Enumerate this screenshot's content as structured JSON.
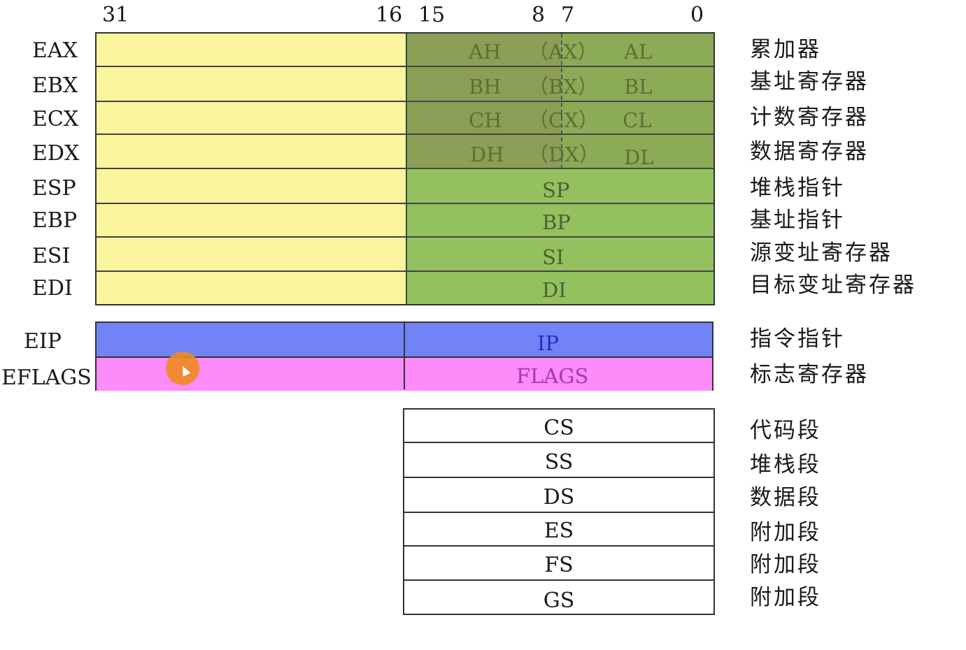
{
  "bit_labels": [
    "31",
    "16",
    "15",
    "8",
    "7",
    "0"
  ],
  "general_registers": [
    {
      "name": "EAX",
      "high": "AH",
      "word": "（AX）",
      "low": "AL",
      "desc": "累加器"
    },
    {
      "name": "EBX",
      "high": "BH",
      "word": "（BX）",
      "low": "BL",
      "desc": "基址寄存器"
    },
    {
      "name": "ECX",
      "high": "CH",
      "word": "（CX）",
      "low": "CL",
      "desc": "计数寄存器"
    },
    {
      "name": "EDX",
      "high": "DH",
      "word": "（DX）",
      "low": "DL",
      "desc": "数据寄存器"
    },
    {
      "name": "ESP",
      "word": "SP",
      "desc": "堆栈指针"
    },
    {
      "name": "EBP",
      "word": "BP",
      "desc": "基址指针"
    },
    {
      "name": "ESI",
      "word": "SI",
      "desc": "源变址寄存器"
    },
    {
      "name": "EDI",
      "word": "DI",
      "desc": "目标变址寄存器"
    }
  ],
  "special_registers": [
    {
      "name": "EIP",
      "word": "IP",
      "desc": "指令指针"
    },
    {
      "name": "EFLAGS",
      "word": "FLAGS",
      "desc": "标志寄存器"
    }
  ],
  "segment_registers": [
    {
      "name": "CS",
      "desc": "代码段"
    },
    {
      "name": "SS",
      "desc": "堆栈段"
    },
    {
      "name": "DS",
      "desc": "数据段"
    },
    {
      "name": "ES",
      "desc": "附加段"
    },
    {
      "name": "FS",
      "desc": "附加段"
    },
    {
      "name": "GS",
      "desc": "附加段"
    }
  ],
  "colors": {
    "upper_half": "#fbf59e",
    "lower_word": "#93c15e",
    "byte_split": "#8cab57",
    "eip": "#7284f5",
    "eflags": "#fb8cf8",
    "ip_text": "#1f2fc4",
    "flags_text": "#b032b0"
  }
}
